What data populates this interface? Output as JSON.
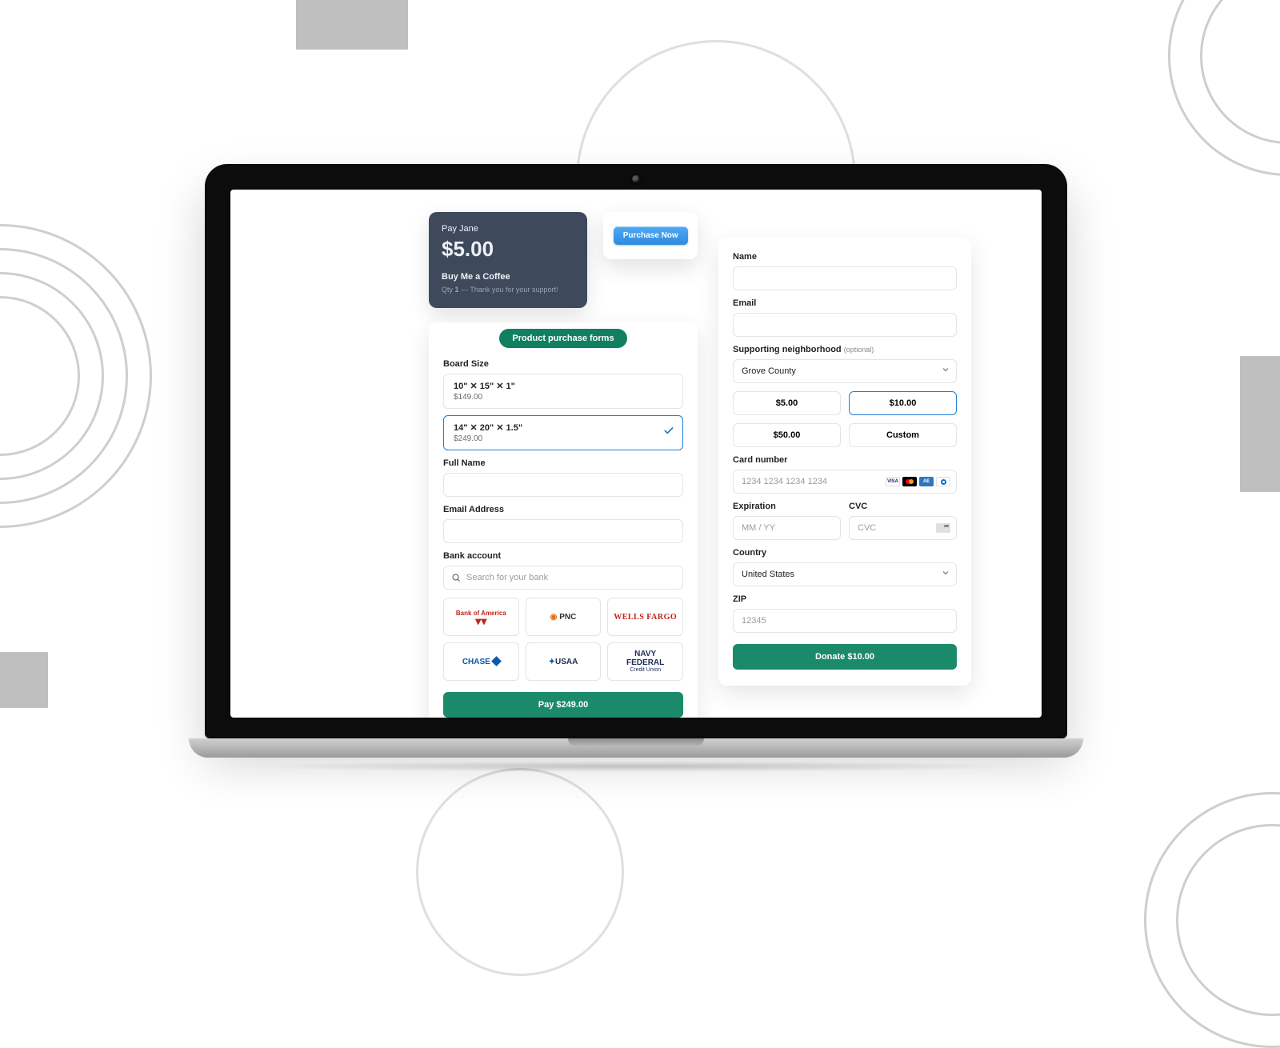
{
  "tip_card": {
    "heading": "Pay Jane",
    "amount": "$5.00",
    "item": "Buy Me a Coffee",
    "qty_label": "Qty",
    "qty": "1",
    "thanks": "— Thank you for your support!"
  },
  "purchase_now_button": "Purchase Now",
  "product_form": {
    "pill": "Product purchase forms",
    "board_size_label": "Board Size",
    "options": [
      {
        "title": "10\" ✕ 15\" ✕ 1\"",
        "price": "$149.00"
      },
      {
        "title": "14\" ✕ 20\" ✕ 1.5\"",
        "price": "$249.00"
      }
    ],
    "full_name_label": "Full Name",
    "email_label": "Email Address",
    "bank_label": "Bank account",
    "bank_search_placeholder": "Search for your bank",
    "banks": [
      "Bank of America",
      "PNC",
      "WELLS FARGO",
      "CHASE",
      "USAA",
      "NAVY FEDERAL Credit Union"
    ],
    "pay_button": "Pay $249.00"
  },
  "donate_form": {
    "name_label": "Name",
    "email_label": "Email",
    "neighborhood_label": "Supporting neighborhood",
    "optional": "(optional)",
    "neighborhood_value": "Grove County",
    "amounts": [
      "$5.00",
      "$10.00",
      "$50.00",
      "Custom"
    ],
    "card_label": "Card number",
    "card_placeholder": "1234 1234 1234 1234",
    "exp_label": "Expiration",
    "exp_placeholder": "MM / YY",
    "cvc_label": "CVC",
    "cvc_placeholder": "CVC",
    "country_label": "Country",
    "country_value": "United States",
    "zip_label": "ZIP",
    "zip_placeholder": "12345",
    "donate_button": "Donate $10.00"
  }
}
